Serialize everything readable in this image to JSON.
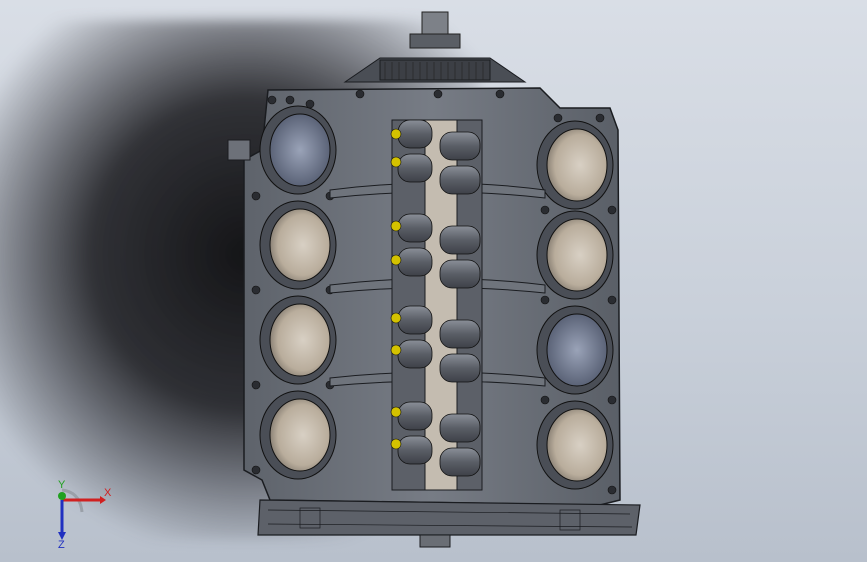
{
  "viewport": {
    "name": "3D model view",
    "background_top": "#d9dee6",
    "background_bottom": "#b8c0cc"
  },
  "model": {
    "body_color": "#6b7079",
    "edge_color": "#1a1c20",
    "bore_liner_color": "#c9c0b3",
    "bolt_accent_color": "#d4c200"
  },
  "triad": {
    "x_label": "X",
    "y_label": "Y",
    "z_label": "Z",
    "x_color": "#d02020",
    "y_color": "#20a020",
    "z_color": "#2030c0"
  }
}
